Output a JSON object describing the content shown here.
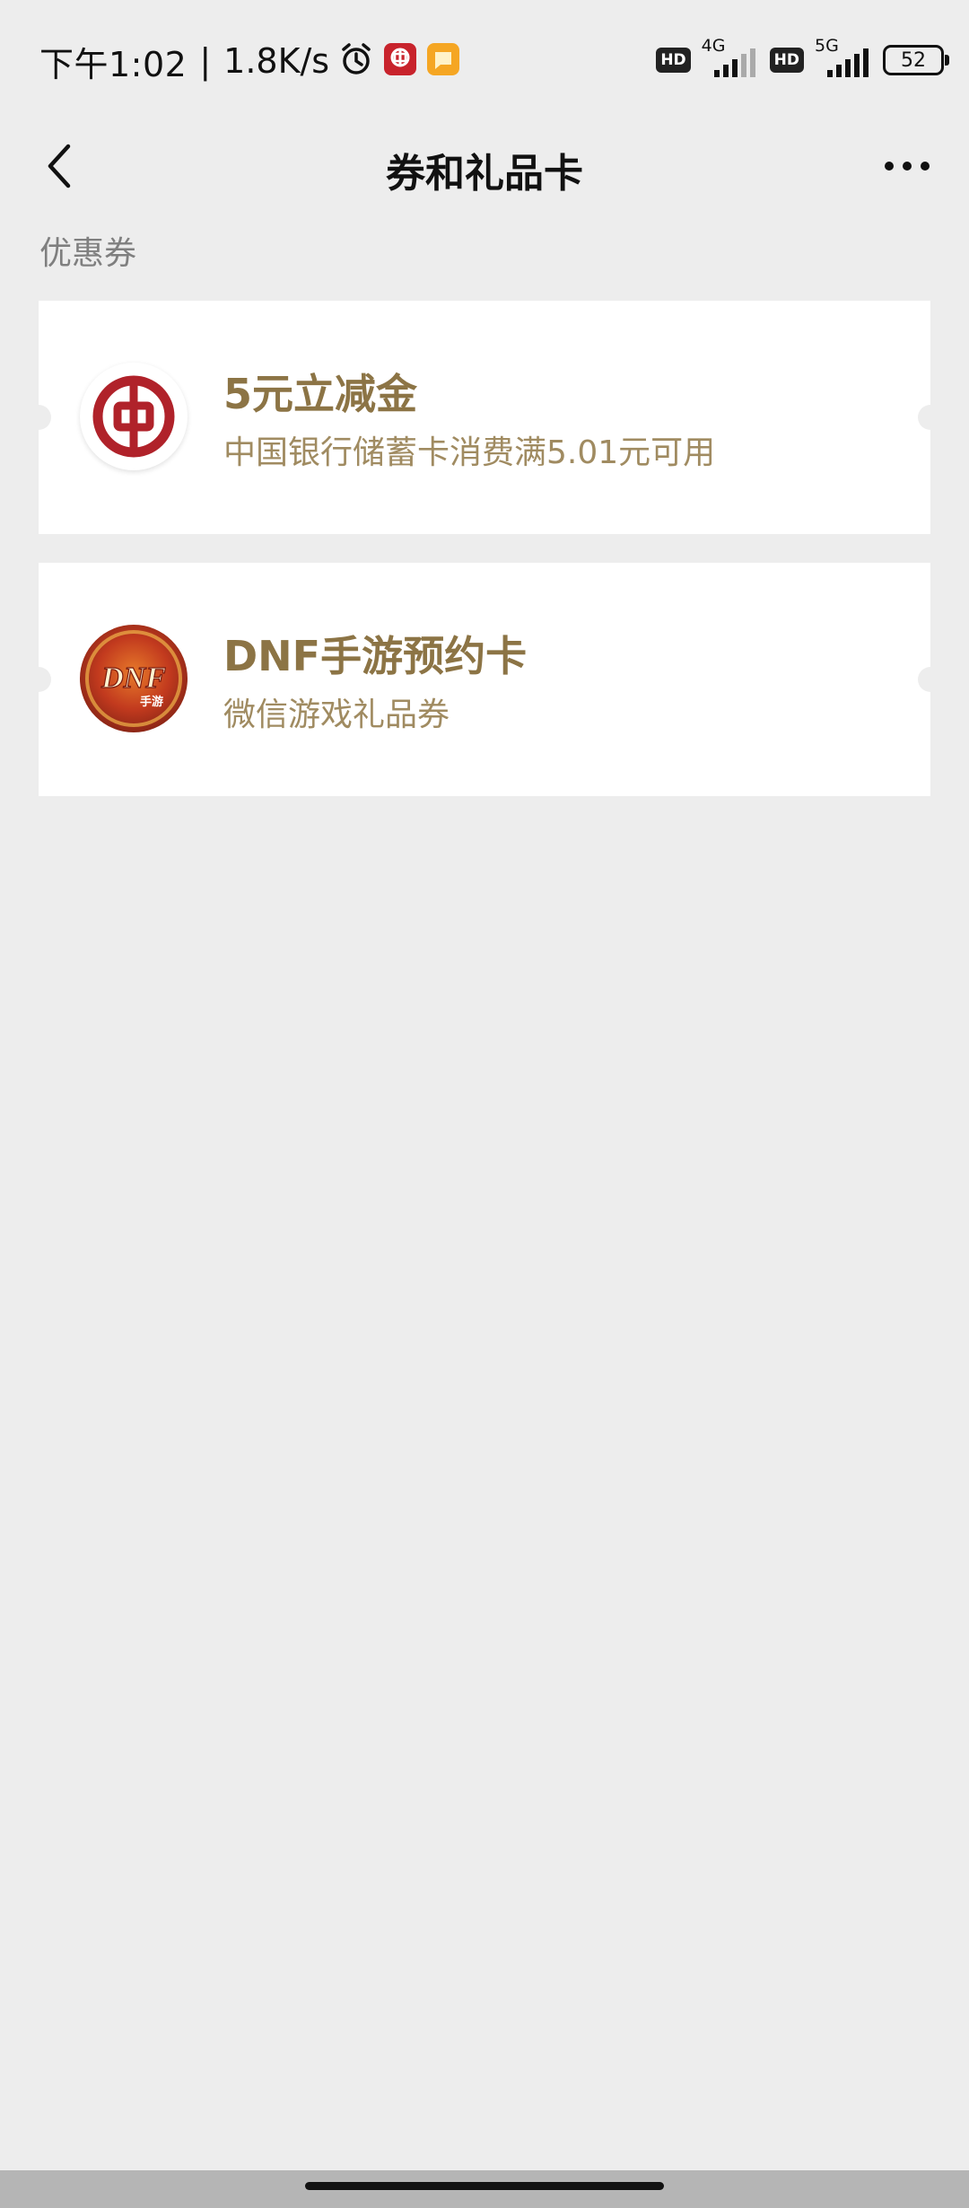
{
  "status_bar": {
    "time": "下午1:02",
    "separator": "|",
    "net_speed": "1.8K/s",
    "alarm_icon": "alarm-clock-icon",
    "app_icons": [
      "bank-app-icon",
      "message-app-icon"
    ],
    "hd1": "HD",
    "net1": "4G",
    "hd2": "HD",
    "net2": "5G",
    "battery": "52"
  },
  "nav": {
    "title": "券和礼品卡",
    "back_icon": "chevron-left-icon",
    "more_icon": "more-dots-icon"
  },
  "section": {
    "title": "优惠券"
  },
  "coupons": [
    {
      "title": "5元立减金",
      "subtitle": "中国银行储蓄卡消费满5.01元可用",
      "icon": "bank-of-china-logo-icon"
    },
    {
      "title": "DNF手游预约卡",
      "subtitle": "微信游戏礼品券",
      "icon": "dnf-game-logo-icon",
      "icon_text": "DNF",
      "icon_badge": "手游"
    }
  ],
  "colors": {
    "background": "#ededed",
    "card": "#ffffff",
    "coupon_title": "#8c7445",
    "coupon_subtitle": "#a08b61",
    "bank_red": "#b0222a"
  }
}
